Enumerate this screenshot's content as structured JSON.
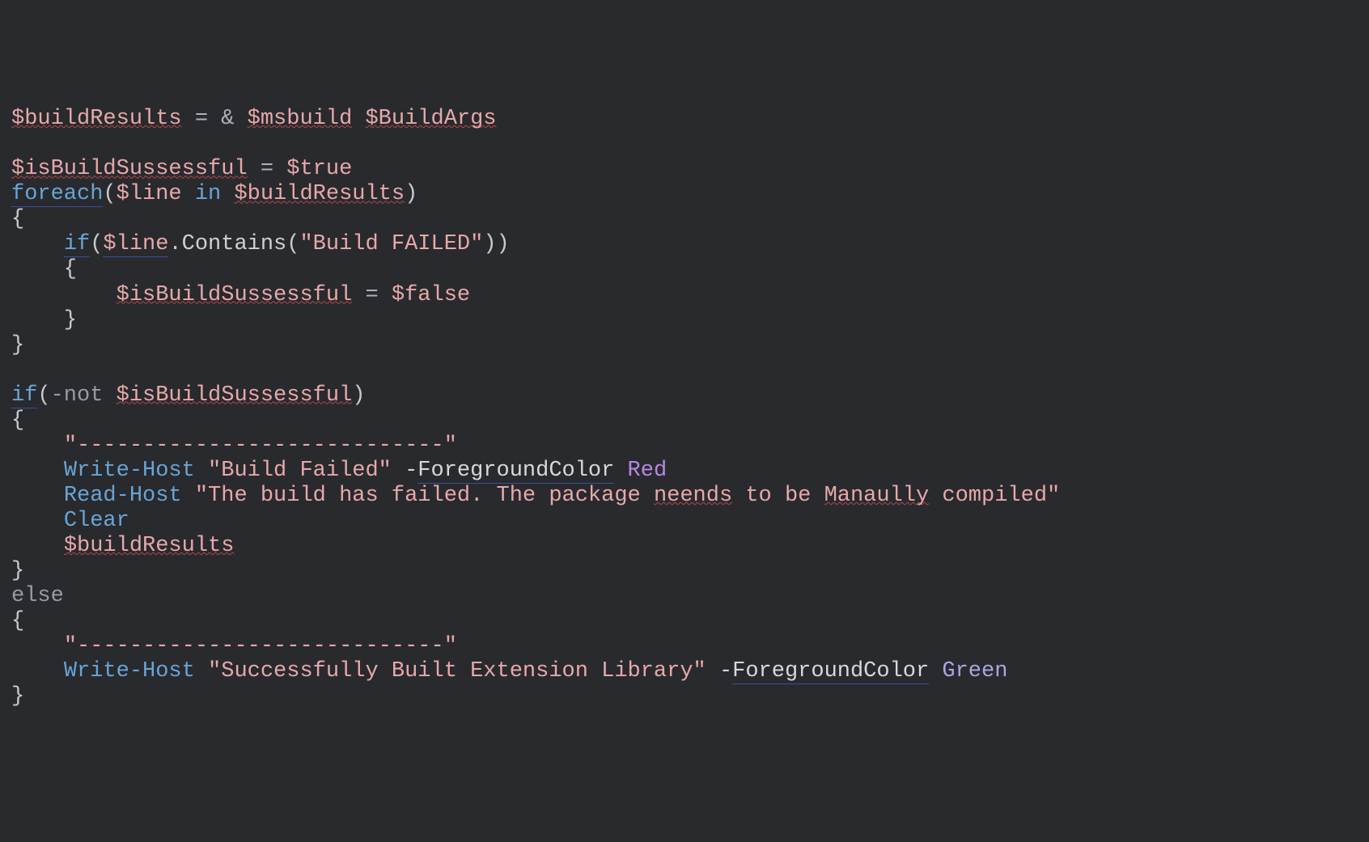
{
  "lines": [
    [
      {
        "t": "$buildResults",
        "c": "tok-var us-warn"
      },
      {
        "t": " ",
        "c": ""
      },
      {
        "t": "=",
        "c": "tok-op"
      },
      {
        "t": " ",
        "c": ""
      },
      {
        "t": "&",
        "c": "tok-op"
      },
      {
        "t": " ",
        "c": ""
      },
      {
        "t": "$msbuild",
        "c": "tok-var us-warn"
      },
      {
        "t": " ",
        "c": ""
      },
      {
        "t": "$BuildArgs",
        "c": "tok-var us-warn"
      }
    ],
    [],
    [
      {
        "t": "$isBuildSussessful",
        "c": "tok-var us-warn"
      },
      {
        "t": " ",
        "c": ""
      },
      {
        "t": "=",
        "c": "tok-op"
      },
      {
        "t": " ",
        "c": ""
      },
      {
        "t": "$true",
        "c": "tok-var"
      }
    ],
    [
      {
        "t": "foreach",
        "c": "tok-cmd us-blue"
      },
      {
        "t": "(",
        "c": "tok-punct"
      },
      {
        "t": "$line",
        "c": "tok-var"
      },
      {
        "t": " ",
        "c": ""
      },
      {
        "t": "in",
        "c": "tok-cmd"
      },
      {
        "t": " ",
        "c": ""
      },
      {
        "t": "$buildResults",
        "c": "tok-var us-warn"
      },
      {
        "t": ")",
        "c": "tok-punct"
      }
    ],
    [
      {
        "t": "{",
        "c": "tok-punct"
      }
    ],
    [
      {
        "t": "    ",
        "c": ""
      },
      {
        "t": "if",
        "c": "tok-cmd us-blue"
      },
      {
        "t": "(",
        "c": "tok-punct"
      },
      {
        "t": "$line",
        "c": "tok-var us-blue"
      },
      {
        "t": ".",
        "c": "tok-punct"
      },
      {
        "t": "Contains",
        "c": "tok-method"
      },
      {
        "t": "(",
        "c": "tok-punct"
      },
      {
        "t": "\"Build FAILED\"",
        "c": "tok-str"
      },
      {
        "t": "))",
        "c": "tok-punct"
      }
    ],
    [
      {
        "t": "    {",
        "c": "tok-punct"
      }
    ],
    [
      {
        "t": "        ",
        "c": ""
      },
      {
        "t": "$isBuildSussessful",
        "c": "tok-var us-warn"
      },
      {
        "t": " ",
        "c": ""
      },
      {
        "t": "=",
        "c": "tok-op"
      },
      {
        "t": " ",
        "c": ""
      },
      {
        "t": "$false",
        "c": "tok-var"
      }
    ],
    [
      {
        "t": "    }",
        "c": "tok-punct"
      }
    ],
    [
      {
        "t": "}",
        "c": "tok-punct"
      }
    ],
    [],
    [
      {
        "t": "if",
        "c": "tok-cmd us-blue"
      },
      {
        "t": "(",
        "c": "tok-punct"
      },
      {
        "t": "-not",
        "c": "tok-kw"
      },
      {
        "t": " ",
        "c": ""
      },
      {
        "t": "$isBuildSussessful",
        "c": "tok-var us-warn"
      },
      {
        "t": ")",
        "c": "tok-punct"
      }
    ],
    [
      {
        "t": "{",
        "c": "tok-punct"
      }
    ],
    [
      {
        "t": "    ",
        "c": ""
      },
      {
        "t": "\"----------------------------\"",
        "c": "tok-str"
      }
    ],
    [
      {
        "t": "    ",
        "c": ""
      },
      {
        "t": "Write-Host",
        "c": "tok-cmd"
      },
      {
        "t": " ",
        "c": ""
      },
      {
        "t": "\"Build Failed\"",
        "c": "tok-str"
      },
      {
        "t": " ",
        "c": ""
      },
      {
        "t": "-",
        "c": "tok-ident"
      },
      {
        "t": "ForegroundColor",
        "c": "tok-ident us-blue"
      },
      {
        "t": " ",
        "c": ""
      },
      {
        "t": "Red",
        "c": "tok-enum1"
      }
    ],
    [
      {
        "t": "    ",
        "c": ""
      },
      {
        "t": "Read-Host",
        "c": "tok-cmd"
      },
      {
        "t": " ",
        "c": ""
      },
      {
        "t": "\"The build has failed. The package ",
        "c": "tok-str"
      },
      {
        "t": "neends",
        "c": "tok-str us-warn"
      },
      {
        "t": " to be ",
        "c": "tok-str"
      },
      {
        "t": "Manaully",
        "c": "tok-str us-warn"
      },
      {
        "t": " compiled\"",
        "c": "tok-str"
      }
    ],
    [
      {
        "t": "    ",
        "c": ""
      },
      {
        "t": "Clear",
        "c": "tok-cmd"
      }
    ],
    [
      {
        "t": "    ",
        "c": ""
      },
      {
        "t": "$buildResults",
        "c": "tok-var us-warn"
      }
    ],
    [
      {
        "t": "}",
        "c": "tok-punct"
      }
    ],
    [
      {
        "t": "else",
        "c": "tok-kw"
      }
    ],
    [
      {
        "t": "{",
        "c": "tok-punct"
      }
    ],
    [
      {
        "t": "    ",
        "c": ""
      },
      {
        "t": "\"----------------------------\"",
        "c": "tok-str"
      }
    ],
    [
      {
        "t": "    ",
        "c": ""
      },
      {
        "t": "Write-Host",
        "c": "tok-cmd"
      },
      {
        "t": " ",
        "c": ""
      },
      {
        "t": "\"Successfully Built Extension Library\"",
        "c": "tok-str"
      },
      {
        "t": " ",
        "c": ""
      },
      {
        "t": "-",
        "c": "tok-ident"
      },
      {
        "t": "ForegroundColor",
        "c": "tok-ident us-blue"
      },
      {
        "t": " ",
        "c": ""
      },
      {
        "t": "Green",
        "c": "tok-enum2"
      }
    ],
    [
      {
        "t": "}",
        "c": "tok-punct"
      }
    ]
  ]
}
